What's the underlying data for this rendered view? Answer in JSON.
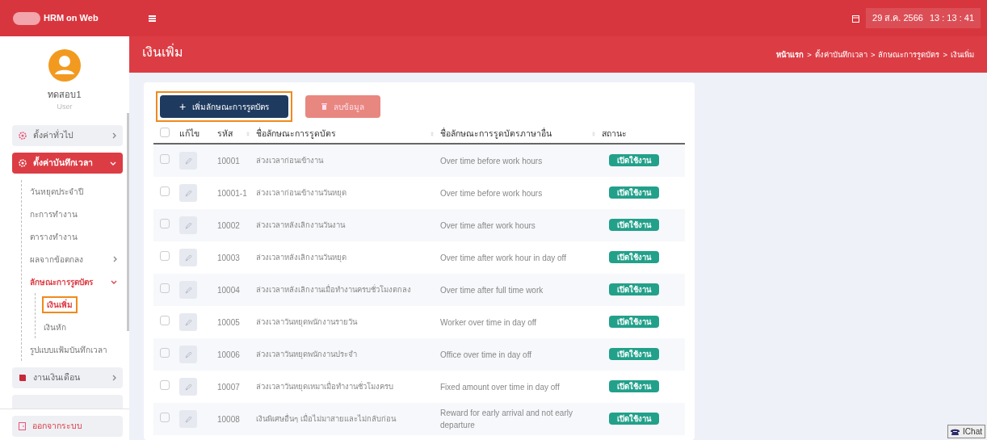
{
  "topbar": {
    "app_name": "HRM on Web",
    "date": "29 ส.ค. 2566",
    "time": "13 : 13 : 41"
  },
  "sidebar": {
    "user": {
      "name": "ทดสอบ1",
      "role": "User"
    },
    "menu": [
      {
        "label": "ตั้งค่าทั่วไป",
        "kind": "settings",
        "selected": false,
        "expanded": false
      },
      {
        "label": "ตั้งค่าบันทึกเวลา",
        "kind": "settings",
        "selected": true,
        "expanded": true,
        "children": [
          {
            "label": "วันหยุดประจำปี",
            "selected": false
          },
          {
            "label": "กะการทำงาน",
            "selected": false
          },
          {
            "label": "ตารางทำงาน",
            "selected": false
          },
          {
            "label": "ผลจากข้อตกลง",
            "selected": false,
            "expanded": false
          },
          {
            "label": "ลักษณะการรูดบัตร",
            "selected": true,
            "expanded": true,
            "children": [
              {
                "label": "เงินเพิ่ม",
                "selected": true,
                "highlighted": true
              },
              {
                "label": "เงินหัก",
                "selected": false
              }
            ]
          },
          {
            "label": "รูปแบบแฟ้มบันทึกเวลา",
            "selected": false
          }
        ]
      },
      {
        "label": "งานเงินเดือน",
        "kind": "payroll",
        "selected": false,
        "expanded": false
      }
    ],
    "logout": "ออกจากระบบ"
  },
  "page_title": "เงินเพิ่ม",
  "breadcrumb": {
    "separator": ">",
    "items": [
      "หน้าแรก",
      "ตั้งค่าบันทึกเวลา",
      "ลักษณะการรูดบัตร",
      "เงินเพิ่ม"
    ]
  },
  "toolbar": {
    "add_button": {
      "label": "เพิ่มลักษณะการรูดบัตร",
      "icon": "+",
      "highlighted": true
    },
    "delete_button": {
      "label": "ลบข้อมูล",
      "disabled": true
    }
  },
  "table": {
    "select_all": {
      "checked": false
    },
    "columns": [
      "แก้ไข",
      "รหัส",
      "ชื่อลักษณะการรูดบัตร",
      "ชื่อลักษณะการรูดบัตรภาษาอื่น",
      "สถานะ"
    ],
    "rows": [
      {
        "checked": false,
        "code": "10001",
        "name": "ล่วงเวลาก่อนเข้างาน",
        "other_name": "Over time before work hours",
        "status": "เปิดใช้งาน"
      },
      {
        "checked": false,
        "code": "10001-1",
        "name": "ล่วงเวลาก่อนเข้างานวันหยุด",
        "other_name": "Over time before work hours",
        "status": "เปิดใช้งาน"
      },
      {
        "checked": false,
        "code": "10002",
        "name": "ล่วงเวลาหลังเลิกงานวันงาน",
        "other_name": "Over time after work hours",
        "status": "เปิดใช้งาน"
      },
      {
        "checked": false,
        "code": "10003",
        "name": "ล่วงเวลาหลังเลิกงานวันหยุด",
        "other_name": "Over time after work hour in day off",
        "status": "เปิดใช้งาน"
      },
      {
        "checked": false,
        "code": "10004",
        "name": "ล่วงเวลาหลังเลิกงานเมื่อทำงานครบชั่วโมงตกลง",
        "other_name": "Over time after full time work",
        "status": "เปิดใช้งาน"
      },
      {
        "checked": false,
        "code": "10005",
        "name": "ล่วงเวลาวันหยุดพนักงานรายวัน",
        "other_name": "Worker over time in day off",
        "status": "เปิดใช้งาน"
      },
      {
        "checked": false,
        "code": "10006",
        "name": "ล่วงเวลาวันหยุดพนักงานประจำ",
        "other_name": "Office over time in day off",
        "status": "เปิดใช้งาน"
      },
      {
        "checked": false,
        "code": "10007",
        "name": "ล่วงเวลาวันหยุดเหมาเมื่อทำงานชั่วโมงครบ",
        "other_name": "Fixed amount over time in day off",
        "status": "เปิดใช้งาน"
      },
      {
        "checked": false,
        "code": "10008",
        "name": "เงินพิเศษอื่นๆ เมื่อไม่มาสายและไม่กลับก่อน",
        "other_name": "Reward for early arrival and not early departure",
        "status": "เปิดใช้งาน"
      }
    ]
  },
  "chat_button": "IChat"
}
